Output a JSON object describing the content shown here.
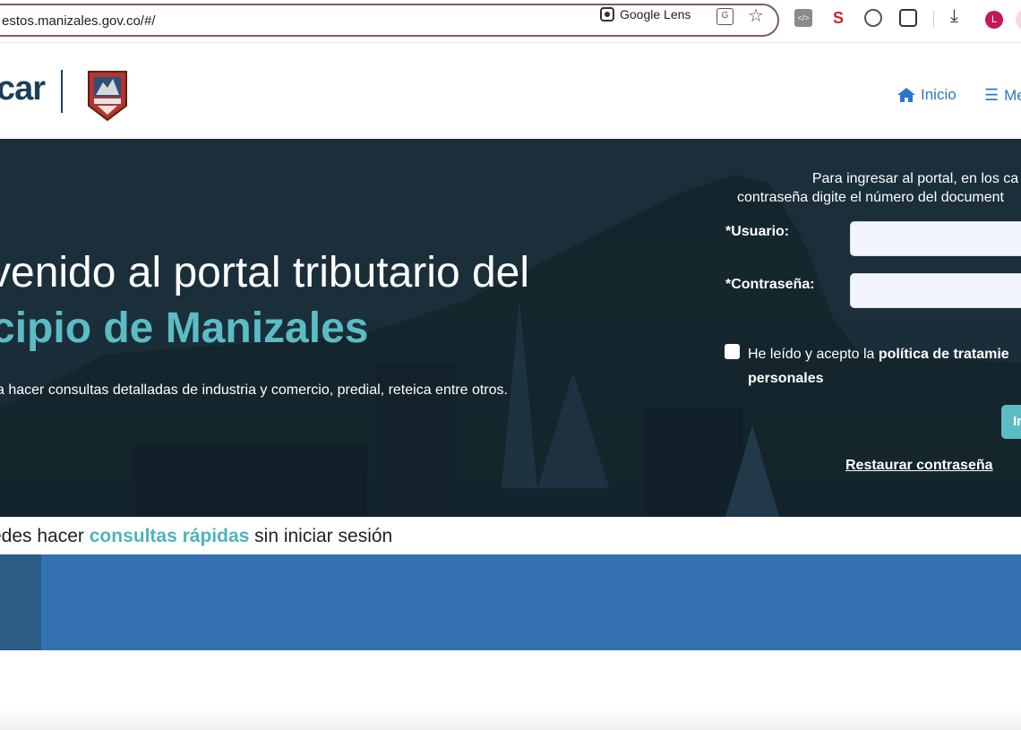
{
  "browser": {
    "url": "estos.manizales.gov.co/#/",
    "lens_label": "Google Lens",
    "avatar_initial": "L"
  },
  "header": {
    "logo_text": "car",
    "nav": [
      {
        "label": "Inicio",
        "icon": "home-icon"
      },
      {
        "label": "Me",
        "icon": "menu-icon"
      }
    ]
  },
  "hero": {
    "title_line1": "venido al portal tributario del",
    "title_line2": "cipio de Manizales",
    "subtitle": "a hacer consultas detalladas de industria y comercio, predial, reteica entre otros."
  },
  "login": {
    "info_line1": "Para ingresar al portal, en los ca",
    "info_line2": "contraseña digite el número del document",
    "user_label": "*Usuario:",
    "user_value": "",
    "password_label": "*Contraseña:",
    "password_value": "",
    "policy_text_before": "He leído y acepto la ",
    "policy_text_bold": "política de tratamie",
    "policy_text_line2": "personales",
    "policy_checked": false,
    "submit_label": "In",
    "reset_link": "Restaurar contraseña"
  },
  "quick": {
    "before": "edes hacer ",
    "highlight": "consultas rápidas",
    "after": " sin iniciar sesión"
  },
  "colors": {
    "accent": "#5cbcc4",
    "link": "#2a77c9",
    "band": "#3371b0",
    "hero_bg": "#1b2f3b"
  }
}
